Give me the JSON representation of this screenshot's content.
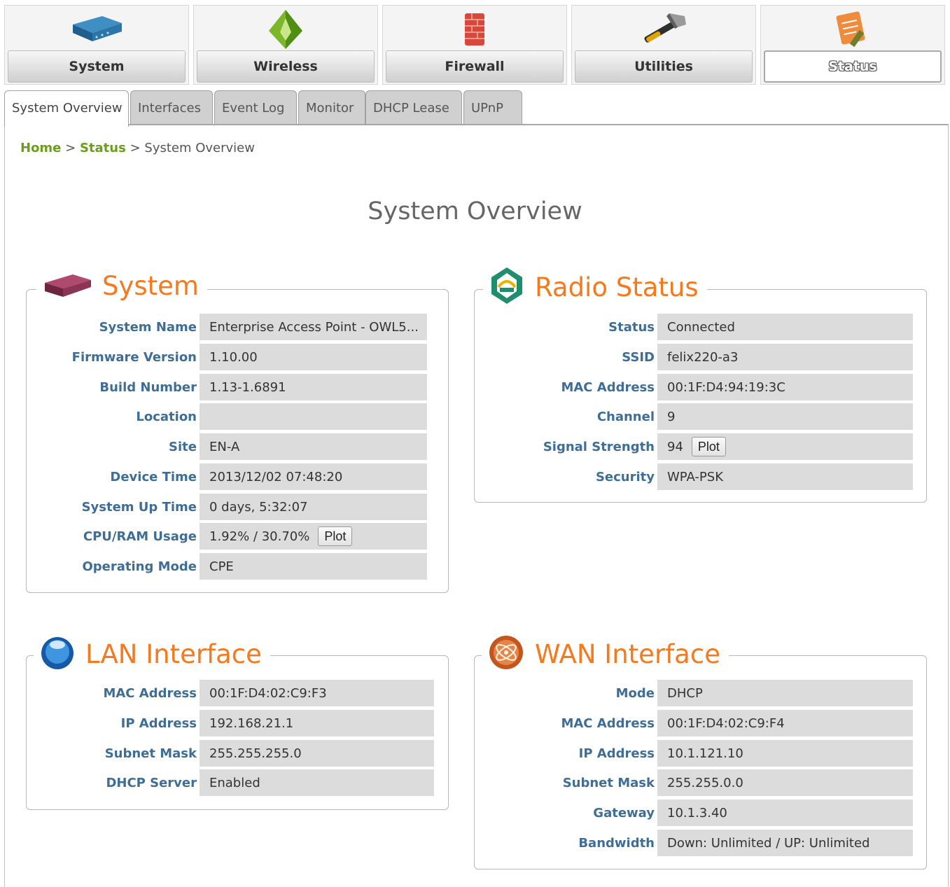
{
  "nav": {
    "items": [
      {
        "label": "System",
        "icon": "router-icon"
      },
      {
        "label": "Wireless",
        "icon": "wireless-pyramid-icon"
      },
      {
        "label": "Firewall",
        "icon": "firewall-brick-icon"
      },
      {
        "label": "Utilities",
        "icon": "hammer-icon"
      },
      {
        "label": "Status",
        "icon": "clipboard-pencil-icon",
        "active": true
      }
    ]
  },
  "tabs": [
    "System Overview",
    "Interfaces",
    "Event Log",
    "Monitor",
    "DHCP Lease",
    "UPnP"
  ],
  "breadcrumb": {
    "home": "Home",
    "sep1": ">",
    "status": "Status",
    "sep2": ">",
    "current": "System Overview"
  },
  "page_title": "System Overview",
  "system": {
    "title": "System",
    "rows": [
      {
        "label": "System Name",
        "value": "Enterprise Access Point - OWL5..."
      },
      {
        "label": "Firmware Version",
        "value": "1.10.00"
      },
      {
        "label": "Build Number",
        "value": "1.13-1.6891"
      },
      {
        "label": "Location",
        "value": ""
      },
      {
        "label": "Site",
        "value": "EN-A"
      },
      {
        "label": "Device Time",
        "value": "2013/12/02 07:48:20"
      },
      {
        "label": "System Up Time",
        "value": "0 days, 5:32:07"
      },
      {
        "label": "CPU/RAM Usage",
        "value": "1.92% / 30.70%",
        "button": "Plot"
      },
      {
        "label": "Operating Mode",
        "value": "CPE"
      }
    ]
  },
  "radio": {
    "title": "Radio Status",
    "rows": [
      {
        "label": "Status",
        "value": "Connected"
      },
      {
        "label": "SSID",
        "value": "felix220-a3"
      },
      {
        "label": "MAC Address",
        "value": "00:1F:D4:94:19:3C"
      },
      {
        "label": "Channel",
        "value": "9"
      },
      {
        "label": "Signal Strength",
        "value": "94",
        "button": "Plot"
      },
      {
        "label": "Security",
        "value": "WPA-PSK"
      }
    ]
  },
  "lan": {
    "title": "LAN Interface",
    "rows": [
      {
        "label": "MAC Address",
        "value": "00:1F:D4:02:C9:F3"
      },
      {
        "label": "IP Address",
        "value": "192.168.21.1"
      },
      {
        "label": "Subnet Mask",
        "value": "255.255.255.0"
      },
      {
        "label": "DHCP Server",
        "value": "Enabled"
      }
    ]
  },
  "wan": {
    "title": "WAN Interface",
    "rows": [
      {
        "label": "Mode",
        "value": "DHCP"
      },
      {
        "label": "MAC Address",
        "value": "00:1F:D4:02:C9:F4"
      },
      {
        "label": "IP Address",
        "value": "10.1.121.10"
      },
      {
        "label": "Subnet Mask",
        "value": "255.255.0.0"
      },
      {
        "label": "Gateway",
        "value": "10.1.3.40"
      },
      {
        "label": "Bandwidth",
        "value": "Down: Unlimited / UP: Unlimited"
      }
    ]
  },
  "colors": {
    "accent": "#f57a1f",
    "label": "#3e6e98",
    "link": "#6a9e1a"
  }
}
